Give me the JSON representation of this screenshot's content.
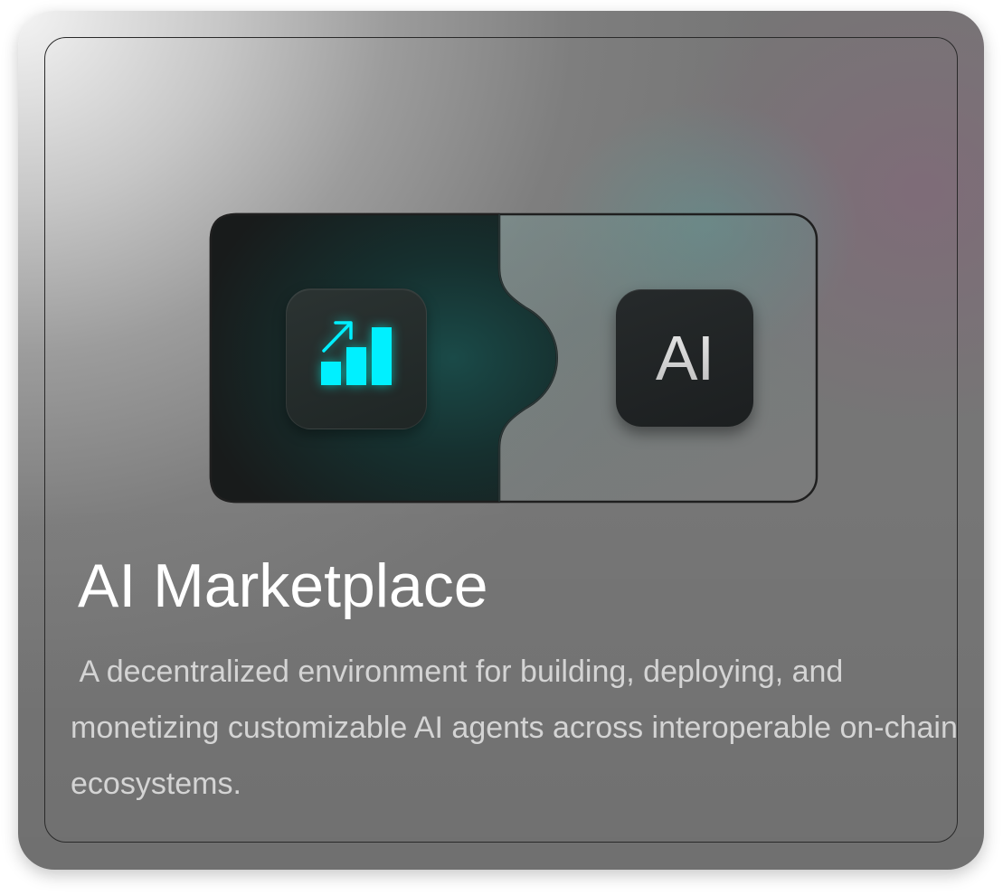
{
  "card": {
    "title": "AI Marketplace",
    "description": " A decentralized environment for building, deploying, and monetizing customizable AI agents across interoperable on-chain ecosystems."
  },
  "illustration": {
    "left_icon": "growth-chart-icon",
    "right_tile_text": "AI"
  },
  "colors": {
    "accent": "#00F0FF",
    "card_dark": "#1C2021",
    "title_text": "#FFFFFF",
    "description_text": "#D4D4D4"
  }
}
